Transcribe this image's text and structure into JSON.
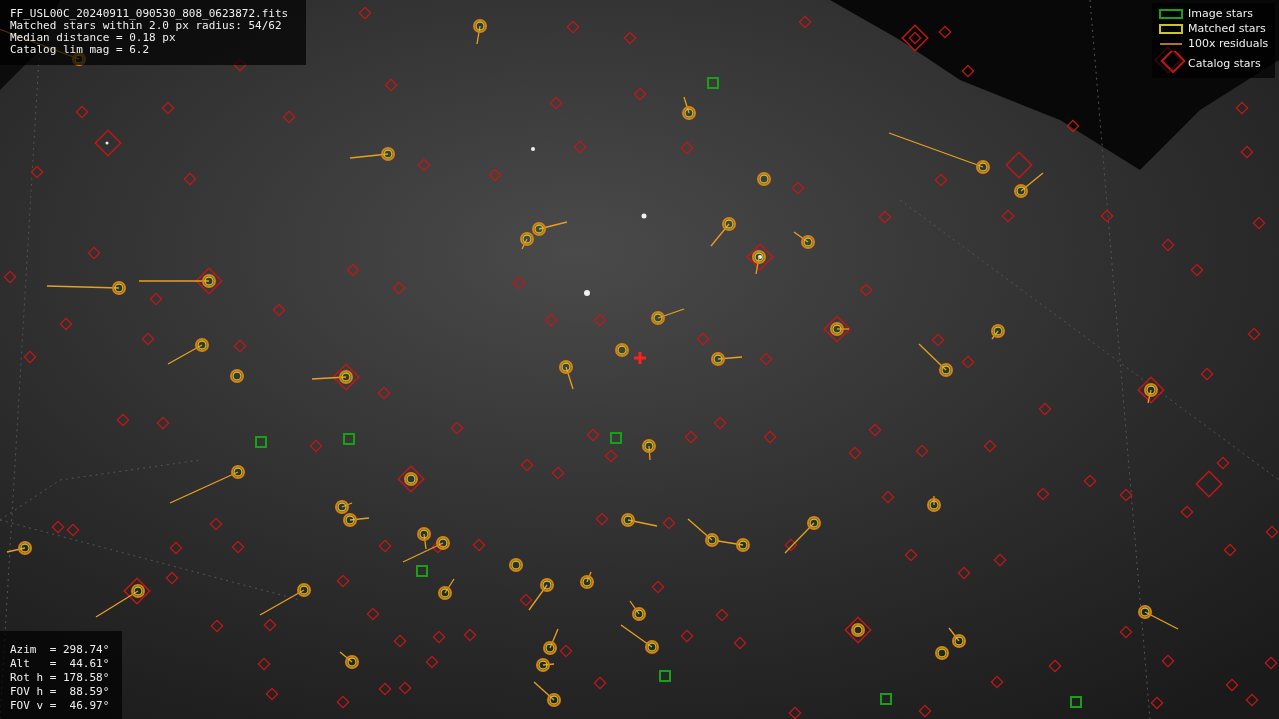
{
  "info_panel": {
    "lines": [
      "FF_USL00C_20240911_090530_808_0623872.fits",
      "Matched stars within 2.0 px radius: 54/62",
      "Median distance = 0.18 px",
      "Catalog lim mag = 6.2"
    ]
  },
  "legend": [
    {
      "label": "Image stars"
    },
    {
      "kind": "matched",
      "label": "Matched stars"
    },
    {
      "kind": "residual",
      "label": "100x residuals"
    },
    {
      "kind": "catalog",
      "label": "Catalog stars"
    }
  ],
  "pointing_panel": {
    "lines": [
      "Azim  = 298.74°",
      "Alt   =  44.61°",
      "Rot h = 178.58°",
      "FOV h =  88.59°",
      "FOV v =  46.97°"
    ]
  }
}
